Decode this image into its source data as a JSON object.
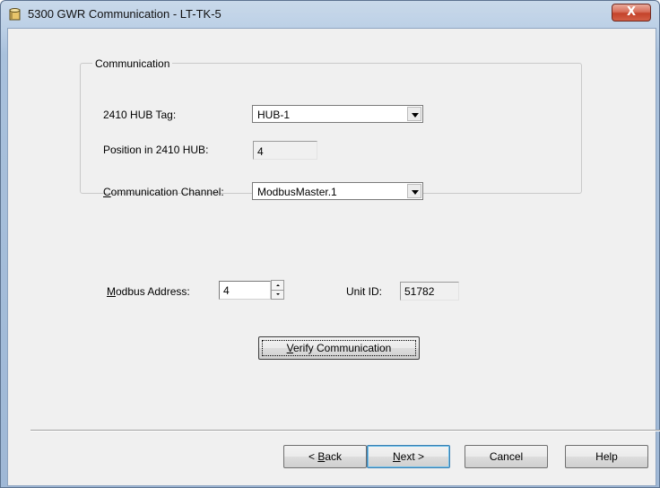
{
  "window": {
    "title": "5300 GWR Communication - LT-TK-5",
    "close_label": "X",
    "icon": "database-cylinder-icon"
  },
  "communication_group": {
    "legend": "Communication",
    "hub_tag_label": "2410 HUB Tag:",
    "hub_tag_value": "HUB-1",
    "position_label": "Position in 2410 HUB:",
    "position_value": "4",
    "channel_label_prefix": "C",
    "channel_label_rest": "ommunication Channel:",
    "channel_value": "ModbusMaster.1"
  },
  "modbus": {
    "address_label_prefix": "M",
    "address_label_rest": "odbus Address:",
    "address_value": "4",
    "unit_id_label": "Unit ID:",
    "unit_id_value": "51782"
  },
  "verify": {
    "label_prefix": "V",
    "label_rest": "erify Communication"
  },
  "footer": {
    "back_prefix": "< ",
    "back_accel": "B",
    "back_rest": "ack",
    "next_accel": "N",
    "next_rest": "ext >",
    "cancel_label": "Cancel",
    "help_label": "Help"
  },
  "colors": {
    "frame": "#a9c1dc",
    "close_button": "#c4432b",
    "dialog_background": "#f0f0f0"
  }
}
